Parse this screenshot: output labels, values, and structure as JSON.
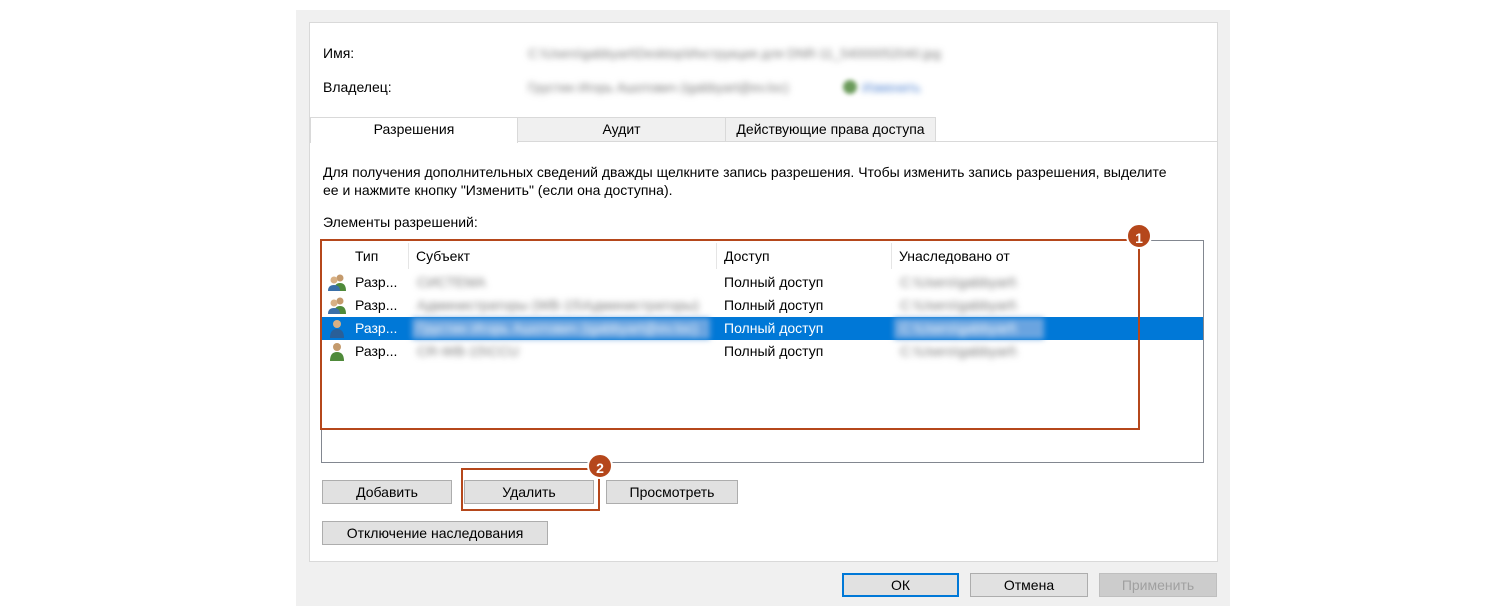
{
  "header": {
    "name_label": "Имя:",
    "name_value": "C:\\Users\\gabbyart\\Desktop\\Инструкция для DNR-11_54000052040.jpg",
    "owner_label": "Владелец:",
    "owner_value": "Грустин Игорь Ашотович (igabbyart@ev.loc)",
    "owner_change": "Изменить"
  },
  "tabs": [
    {
      "label": "Разрешения",
      "active": true
    },
    {
      "label": "Аудит",
      "active": false
    },
    {
      "label": "Действующие права доступа",
      "active": false
    }
  ],
  "instructions": {
    "line1": "Для получения дополнительных сведений дважды щелкните запись разрешения. Чтобы изменить запись разрешения, выделите",
    "line2": "ее и нажмите кнопку \"Изменить\" (если она доступна)."
  },
  "permissions": {
    "label": "Элементы разрешений:",
    "columns": {
      "type": "Тип",
      "subject": "Субъект",
      "access": "Доступ",
      "inherited": "Унаследовано от"
    },
    "rows": [
      {
        "type": "Разр...",
        "subject": "СИСТЕМА",
        "access": "Полный доступ",
        "inherited": "C:\\Users\\gabbyart\\",
        "icon": "group-icon",
        "selected": false
      },
      {
        "type": "Разр...",
        "subject": "Администраторы (WB-15\\Администраторы)",
        "access": "Полный доступ",
        "inherited": "C:\\Users\\gabbyart\\",
        "icon": "group-icon",
        "selected": false
      },
      {
        "type": "Разр...",
        "subject": "Грустин Игорь Ашотович (igabbyart@ev.loc)",
        "access": "Полный доступ",
        "inherited": "C:\\Users\\gabbyart\\",
        "icon": "user-icon",
        "selected": true
      },
      {
        "type": "Разр...",
        "subject": "CR-WB-15\\CCU",
        "access": "Полный доступ",
        "inherited": "C:\\Users\\gabbyart\\",
        "icon": "user-icon",
        "selected": false
      }
    ]
  },
  "buttons": {
    "add": "Добавить",
    "remove": "Удалить",
    "view": "Просмотреть",
    "disable_inheritance": "Отключение наследования"
  },
  "footer": {
    "ok": "ОК",
    "cancel": "Отмена",
    "apply": "Применить"
  },
  "callouts": {
    "one": "1",
    "two": "2"
  },
  "colors": {
    "selection": "#0078d7",
    "callout": "#b5471b"
  }
}
